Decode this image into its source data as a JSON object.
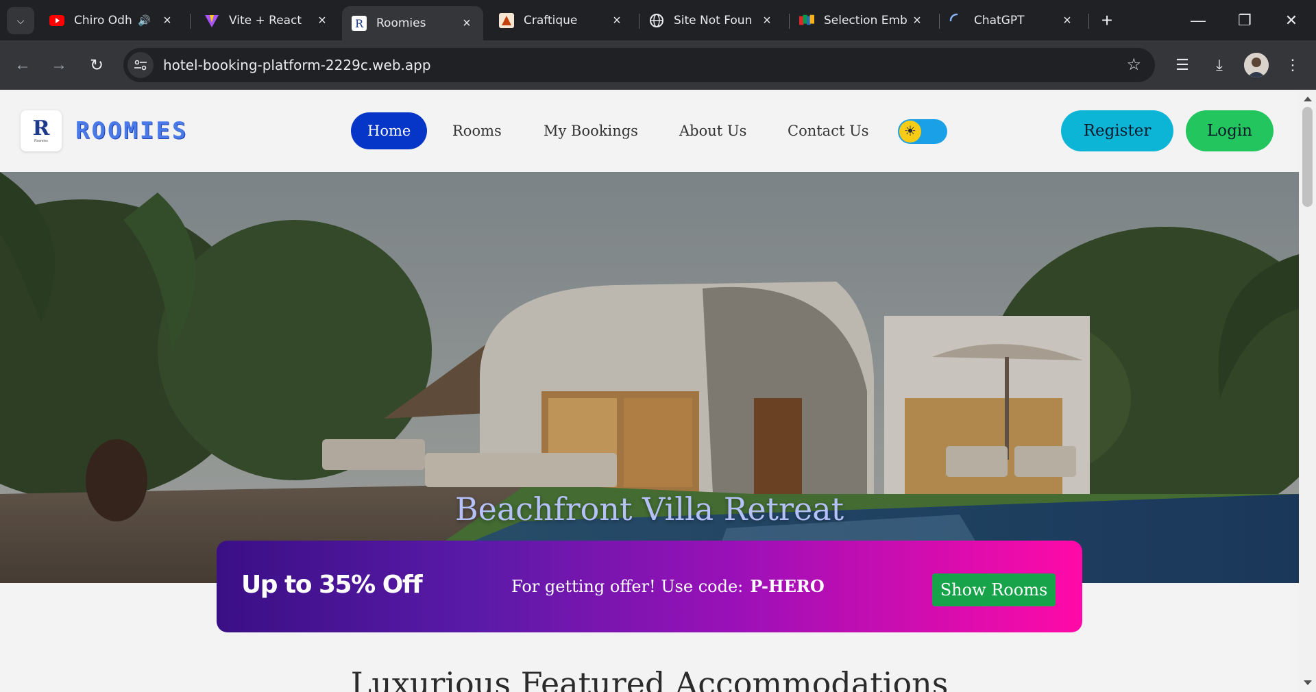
{
  "browser": {
    "tabs": [
      {
        "title": "Chiro Odh",
        "icon": "youtube-icon",
        "has_sound": true
      },
      {
        "title": "Vite + React",
        "icon": "vite-icon"
      },
      {
        "title": "Roomies",
        "icon": "roomies-icon",
        "active": true
      },
      {
        "title": "Craftique",
        "icon": "craftique-icon"
      },
      {
        "title": "Site Not Foun",
        "icon": "globe-icon"
      },
      {
        "title": "Selection Emb",
        "icon": "zoho-icon"
      },
      {
        "title": "ChatGPT",
        "icon": "loading-icon"
      }
    ],
    "new_tab_label": "+",
    "url": "hotel-booking-platform-2229c.web.app"
  },
  "site": {
    "logo_letter": "R",
    "logo_caption": "Roomies",
    "brand_name": "ROOMIES",
    "nav": [
      {
        "label": "Home",
        "active": true
      },
      {
        "label": "Rooms"
      },
      {
        "label": "My Bookings"
      },
      {
        "label": "About Us"
      },
      {
        "label": "Contact Us"
      }
    ],
    "theme_toggle_icon": "sun-icon",
    "register_label": "Register",
    "login_label": "Login",
    "hero_title": "Beachfront Villa Retreat",
    "offer": {
      "headline": "Up to 35% Off",
      "text": "For getting offer! Use code:",
      "code": "P-HERO",
      "button_label": "Show Rooms"
    },
    "section_title": "Luxurious Featured Accommodations"
  },
  "colors": {
    "nav_active": "#0636c8",
    "register": "#0cb4d6",
    "login": "#22c55e",
    "brand": "#4a7ae8",
    "offer_gradient_start": "#3a0f85",
    "offer_gradient_end": "#ff0aa8",
    "offer_button": "#16a34a"
  }
}
